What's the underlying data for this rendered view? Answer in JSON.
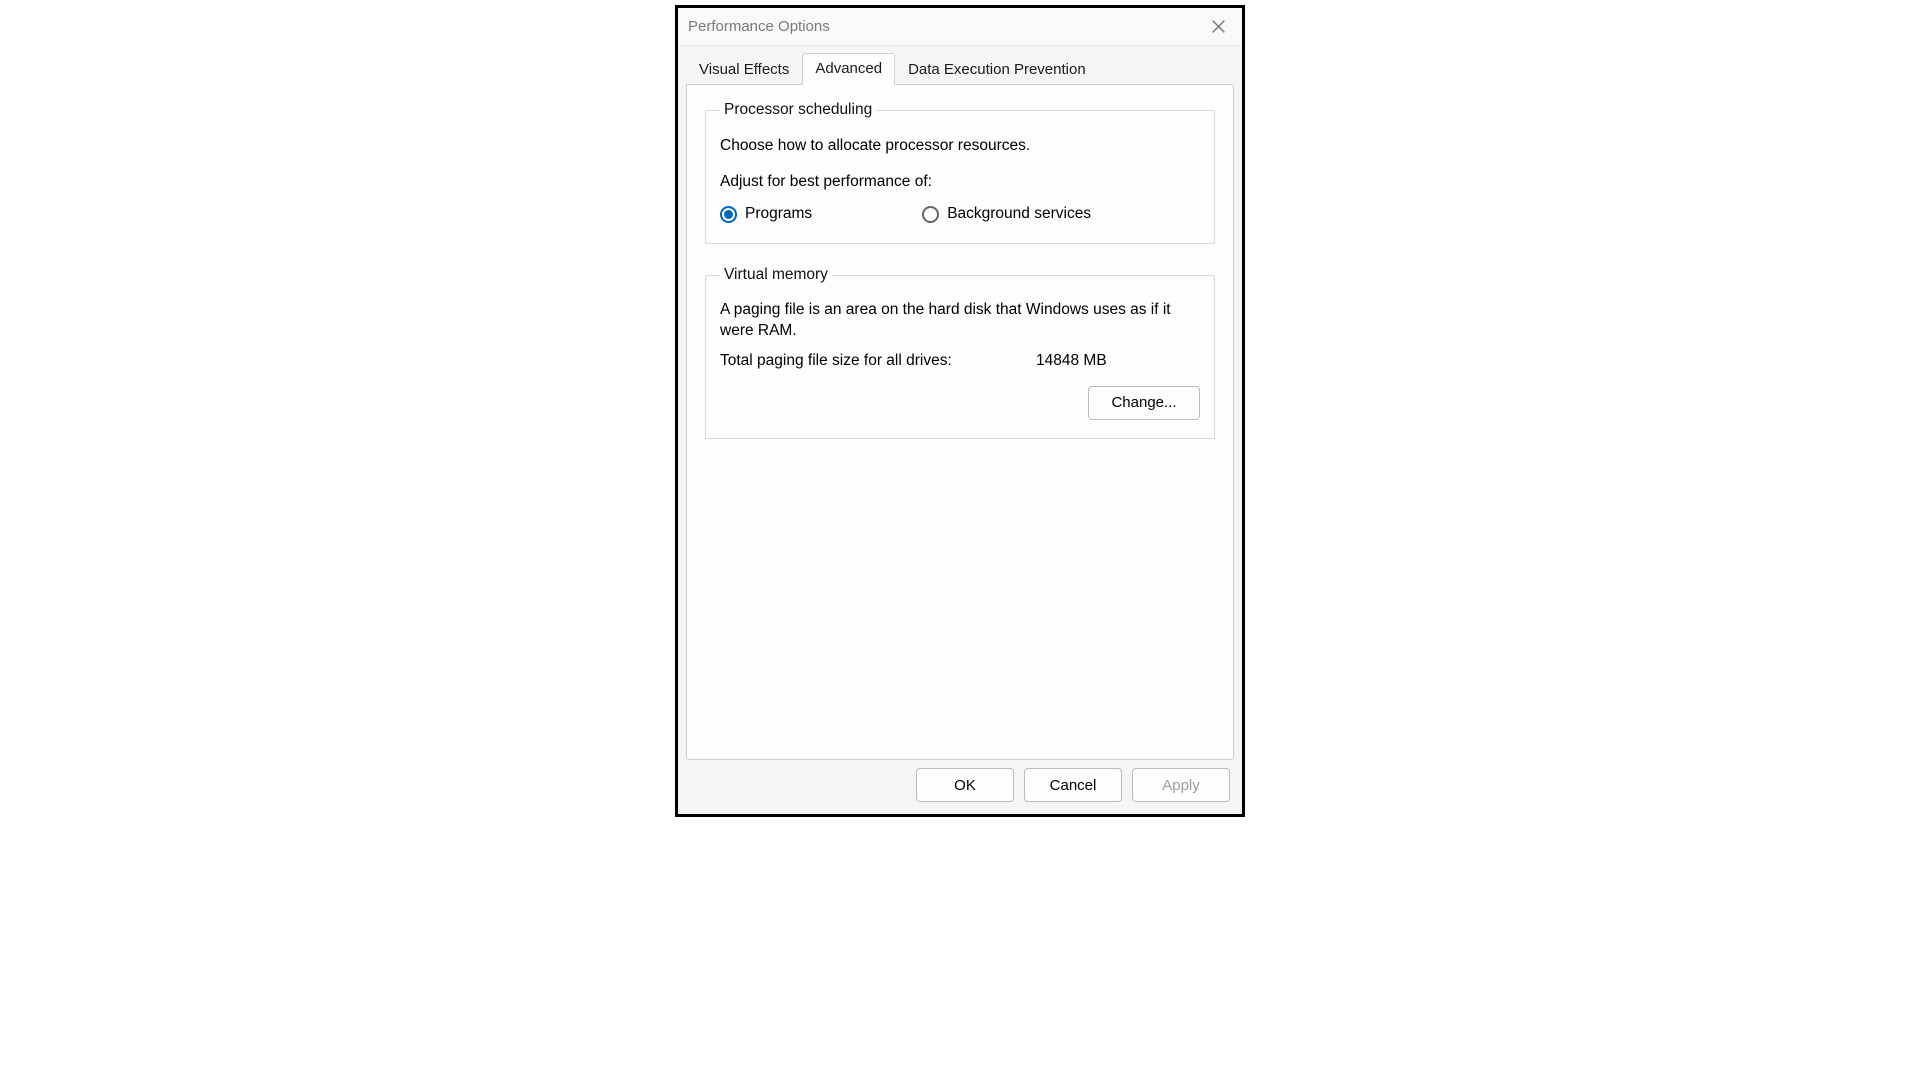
{
  "window": {
    "title": "Performance Options"
  },
  "tabs": {
    "visual_effects": "Visual Effects",
    "advanced": "Advanced",
    "dep": "Data Execution Prevention",
    "active": "advanced"
  },
  "processor_scheduling": {
    "legend": "Processor scheduling",
    "description": "Choose how to allocate processor resources.",
    "subheading": "Adjust for best performance of:",
    "option_programs": "Programs",
    "option_background": "Background services",
    "selected": "programs"
  },
  "virtual_memory": {
    "legend": "Virtual memory",
    "description": "A paging file is an area on the hard disk that Windows uses as if it were RAM.",
    "total_label": "Total paging file size for all drives:",
    "total_value": "14848 MB",
    "change_button": "Change..."
  },
  "buttons": {
    "ok": "OK",
    "cancel": "Cancel",
    "apply": "Apply"
  }
}
